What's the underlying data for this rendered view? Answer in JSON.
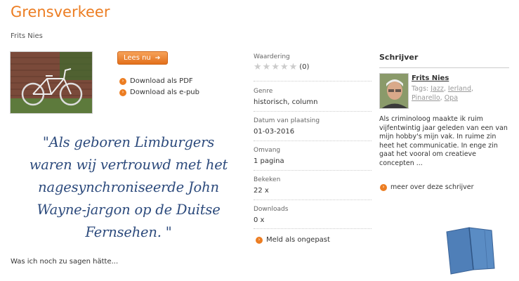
{
  "page": {
    "title": "Grensverkeer",
    "author": "Frits Nies",
    "read_button": "Lees nu",
    "downloads": [
      "Download als PDF",
      "Download als e-pub"
    ],
    "quote": "\"Als geboren Limburgers waren wij vertrouwd met het nagesynchroniseerde John Wayne-jargon op de Duitse Fernsehen. \"",
    "teaser": "Was ich noch zu sagen hätte..."
  },
  "meta": {
    "rating_label": "Waardering",
    "rating_value": 0,
    "rating_count": "(0)",
    "genre_label": "Genre",
    "genre_value": "historisch, column",
    "date_label": "Datum van plaatsing",
    "date_value": "01-03-2016",
    "size_label": "Omvang",
    "size_value": "1 pagina",
    "views_label": "Bekeken",
    "views_value": "22 x",
    "downloads_label": "Downloads",
    "downloads_value": "0 x",
    "report_label": "Meld als ongepast"
  },
  "writer": {
    "heading": "Schrijver",
    "name": "Frits Nies",
    "tags_label": "Tags:",
    "tags": [
      "Jazz",
      "Ierland",
      "Pinarello",
      "Opa"
    ],
    "bio": "Als criminoloog maakte ik ruim vijfentwintig jaar geleden van een van mijn hobby's mijn vak. In ruime zin heet het communicatie. In enge zin gaat het vooral om creatieve concepten ...",
    "more_link": "meer over deze schrijver"
  },
  "colors": {
    "accent": "#ec7d22",
    "quote": "#2c4a7c",
    "book": "#4f7fb8"
  }
}
